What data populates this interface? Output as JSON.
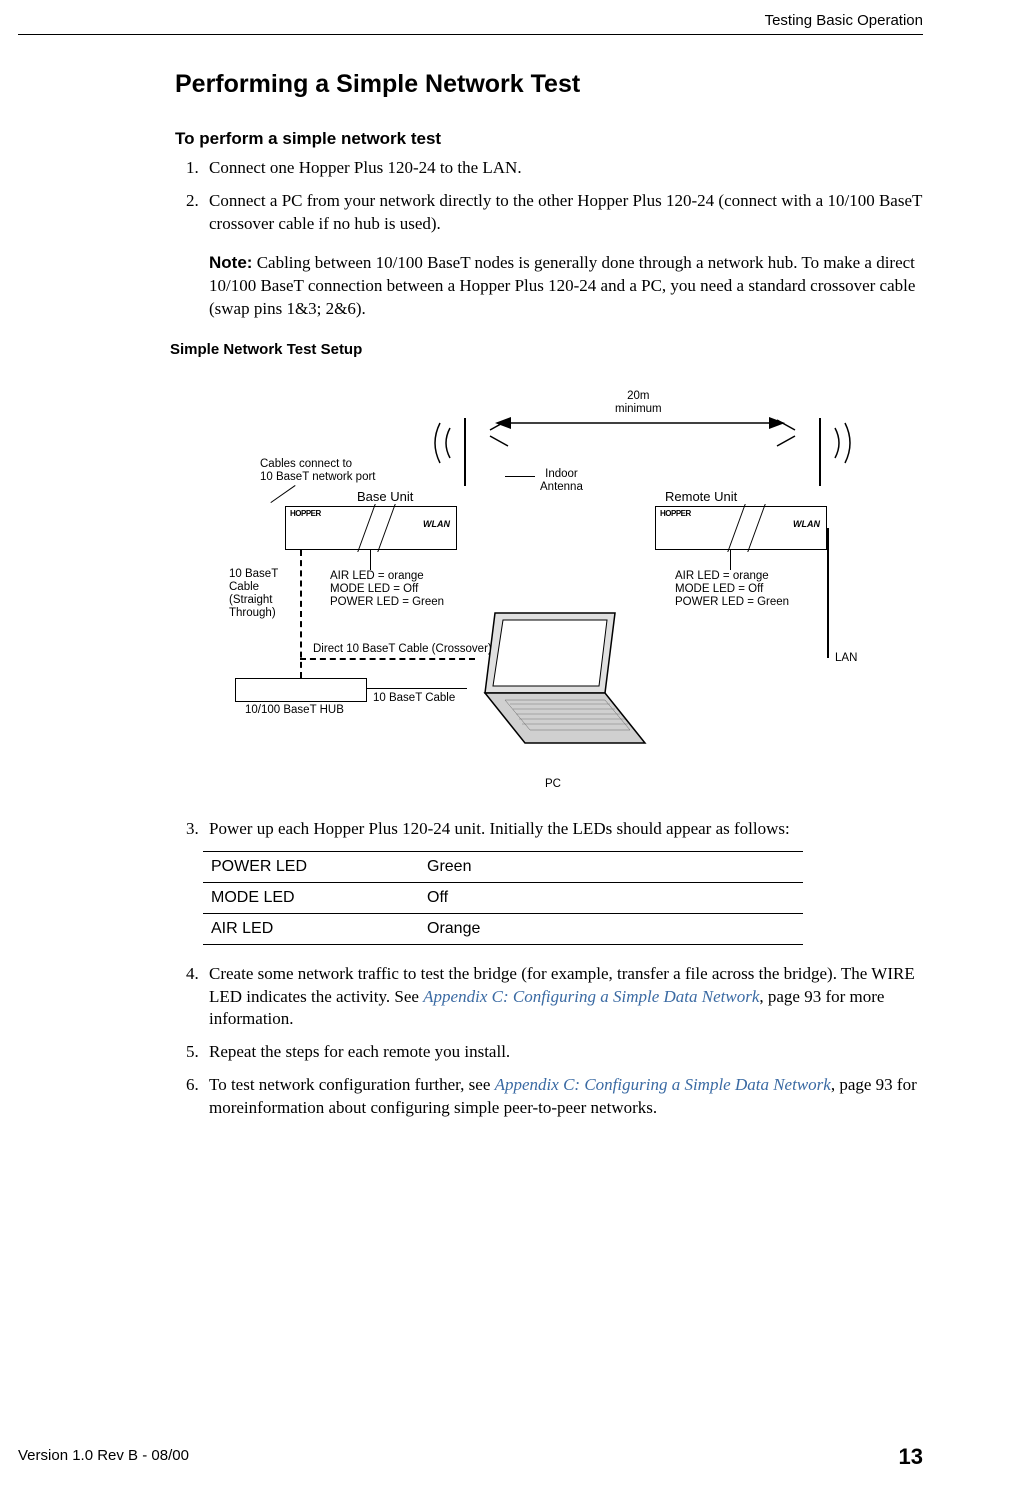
{
  "header": {
    "section": "Testing Basic Operation"
  },
  "title": "Performing a Simple Network Test",
  "proc_heading": "To perform a simple network test",
  "steps": {
    "s1": "Connect one Hopper Plus 120-24 to the LAN.",
    "s2": "Connect a PC from your network directly to the other Hopper Plus 120-24 (connect with a 10/100 BaseT crossover cable if no hub is used).",
    "note_label": "Note:",
    "note_body": " Cabling between 10/100 BaseT nodes is generally done through a network hub. To make a direct 10/100 BaseT connection between a Hopper Plus 120-24 and a PC, you need a standard crossover cable (swap pins 1&3; 2&6).",
    "s3": "Power up each Hopper Plus 120-24 unit. Initially the LEDs should appear as follows:",
    "s4a": "Create some network traffic to test the bridge (for example, transfer a file across the bridge). The WIRE LED indicates the activity. See ",
    "s4_ref": "Appendix C: Configuring a Simple Data Network",
    "s4b": ", page 93 for more information.",
    "s5": "Repeat the steps for each remote you install.",
    "s6a": "To test network configuration further, see ",
    "s6_ref": "Appendix C: Configuring a Simple Data Network",
    "s6b": ", page 93 for moreinformation about configuring simple peer-to-peer networks."
  },
  "fig_caption": "Simple Network Test Setup",
  "figure": {
    "distance": "20m\nminimum",
    "cables_note": "Cables connect to\n10 BaseT network port",
    "base_label": "Base Unit",
    "remote_label": "Remote Unit",
    "indoor_antenna": "Indoor\nAntenna",
    "led_status": "AIR LED = orange\nMODE LED = Off\nPOWER LED = Green",
    "led_status2": "AIR LED = orange\nMODE LED = Off\nPOWER LED = Green",
    "cable_straight": "10 BaseT\nCable\n(Straight\nThrough)",
    "cable_crossover": "Direct 10 BaseT Cable (Crossover)",
    "cable_10bt": "10 BaseT Cable",
    "hub": "10/100 BaseT HUB",
    "pc": "PC",
    "lan": "LAN",
    "brand": "HOPPER",
    "wlan": "WLAN"
  },
  "led_table": [
    {
      "name": "POWER LED",
      "value": "Green"
    },
    {
      "name": "MODE LED",
      "value": "Off"
    },
    {
      "name": "AIR LED",
      "value": "Orange"
    }
  ],
  "footer": {
    "version": "Version 1.0 Rev B - 08/00",
    "page": "13"
  }
}
